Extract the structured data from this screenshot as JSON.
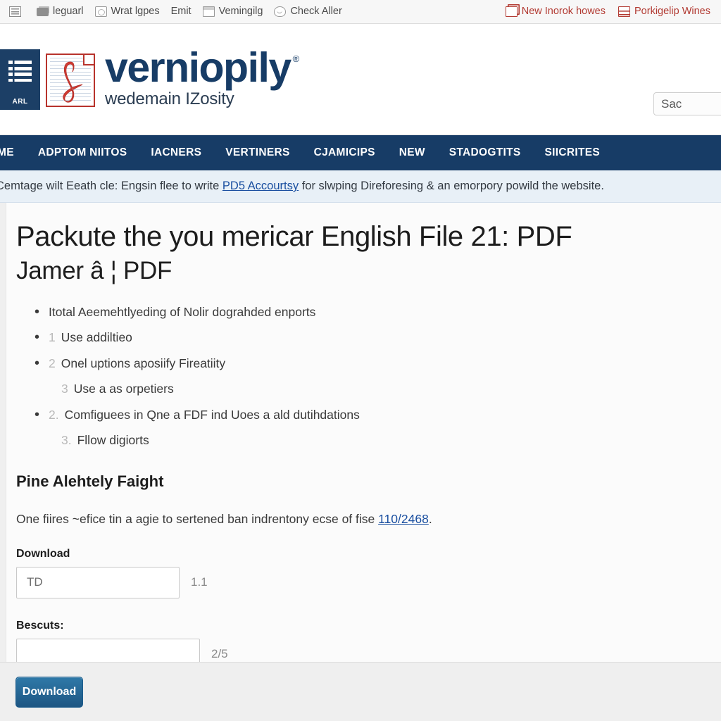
{
  "toolbar": {
    "left_items": [
      {
        "icon": "grid-icon",
        "label": ""
      },
      {
        "icon": "stack-icon",
        "label": "leguarl"
      },
      {
        "icon": "box-icon",
        "label": "Wrat lgpes"
      },
      {
        "icon": "none",
        "label": "Emit"
      },
      {
        "icon": "window-icon",
        "label": "Vemingilg"
      },
      {
        "icon": "face-icon",
        "label": "Check Aller"
      }
    ],
    "right_items": [
      {
        "icon": "copy-icon",
        "label": "New Inorok howes"
      },
      {
        "icon": "cabinet-icon",
        "label": "Porkigelip Wines"
      }
    ],
    "accent_color": "#b23a32"
  },
  "header": {
    "brand_mark_tag": "ARL",
    "brand_title": "verniopily",
    "brand_registered": "®",
    "brand_subtitle": "wedemain IZosity",
    "search_value": "Sac",
    "search_placeholder": "Sac",
    "brand_color": "#173c66",
    "accent_red": "#b8332c"
  },
  "nav": {
    "items": [
      "ME",
      "ADPTOM NIITOS",
      "IACNERS",
      "VERTINERS",
      "CJAMICIPS",
      "NEW",
      "STADOGTITS",
      "SIICRITES"
    ],
    "background": "#173c66"
  },
  "notice": {
    "before_link": "Cemtage wilt Eeath cle: Engsin flee to write ",
    "link_text": "PD5 Accourtsy",
    "after_link": " for slwping Direforesing & an emorpory powild the website.",
    "background": "#e8f0f7",
    "link_color": "#1a4fa0"
  },
  "main": {
    "heading_1": "Packute the you mericar English File 21: PDF",
    "heading_2": "Jamer â ¦ PDF",
    "bullets": [
      {
        "bulleted": true,
        "num": "",
        "text": "Itotal Aeemehtlyeding of Nolir dograhded enports"
      },
      {
        "bulleted": true,
        "num": "1",
        "text": "Use addiltieo"
      },
      {
        "bulleted": true,
        "num": "2",
        "text": "Onel uptions aposiify Fireatiity"
      },
      {
        "bulleted": false,
        "num": "3",
        "text": "Use a as orpetiers"
      },
      {
        "bulleted": true,
        "num": "2.",
        "text": "Comfiguees in Qne a FDF ind Uoes a ald dutihdations"
      },
      {
        "bulleted": false,
        "num": "3.",
        "text": "Fllow digiorts"
      }
    ],
    "section_heading": "Pine Alehtely Faight",
    "paragraph_before_link": "One fiires ~efice tin a agie to sertened ban indrentony ecse of fise ",
    "paragraph_link": "110/2468",
    "paragraph_after_link": ".",
    "fields": [
      {
        "label": "Download",
        "value": "TD",
        "placeholder": "",
        "counter": "1.1"
      },
      {
        "label": "Bescuts:",
        "value": "",
        "placeholder": "",
        "counter": "2/5"
      }
    ]
  },
  "footer": {
    "download_button": "Download",
    "button_color": "#2f79a8"
  }
}
